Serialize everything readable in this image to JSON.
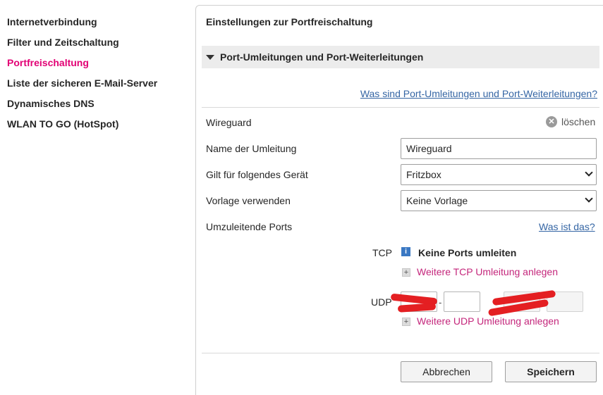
{
  "sidebar": {
    "items": [
      {
        "label": "Internetverbindung",
        "active": false
      },
      {
        "label": "Filter und Zeitschaltung",
        "active": false
      },
      {
        "label": "Portfreischaltung",
        "active": true
      },
      {
        "label": "Liste der sicheren E-Mail-Server",
        "active": false
      },
      {
        "label": "Dynamisches DNS",
        "active": false
      },
      {
        "label": "WLAN TO GO (HotSpot)",
        "active": false
      }
    ]
  },
  "panel": {
    "title": "Einstellungen zur Portfreischaltung",
    "section_label": "Port-Umleitungen und Port-Weiterleitungen",
    "help_link": "Was sind Port-Umleitungen und Port-Weiterleitungen?"
  },
  "entry": {
    "name": "Wireguard",
    "delete_label": "löschen",
    "name_label": "Name der Umleitung",
    "name_value": "Wireguard",
    "device_label": "Gilt für folgendes Gerät",
    "device_value": "Fritzbox",
    "template_label": "Vorlage verwenden",
    "template_value": "Keine Vorlage",
    "ports_label": "Umzuleitende Ports",
    "ports_help": "Was ist das?"
  },
  "tcp": {
    "label": "TCP",
    "info_icon": "i",
    "status": "Keine Ports umleiten",
    "add_link": "Weitere TCP Umleitung anlegen"
  },
  "udp": {
    "label": "UDP",
    "dash": "-",
    "add_link": "Weitere UDP Umleitung anlegen"
  },
  "buttons": {
    "cancel": "Abbrechen",
    "save": "Speichern"
  },
  "colors": {
    "accent": "#e20074",
    "link": "#3465a4",
    "add_link": "#c4267b",
    "redaction": "#e41f22"
  }
}
